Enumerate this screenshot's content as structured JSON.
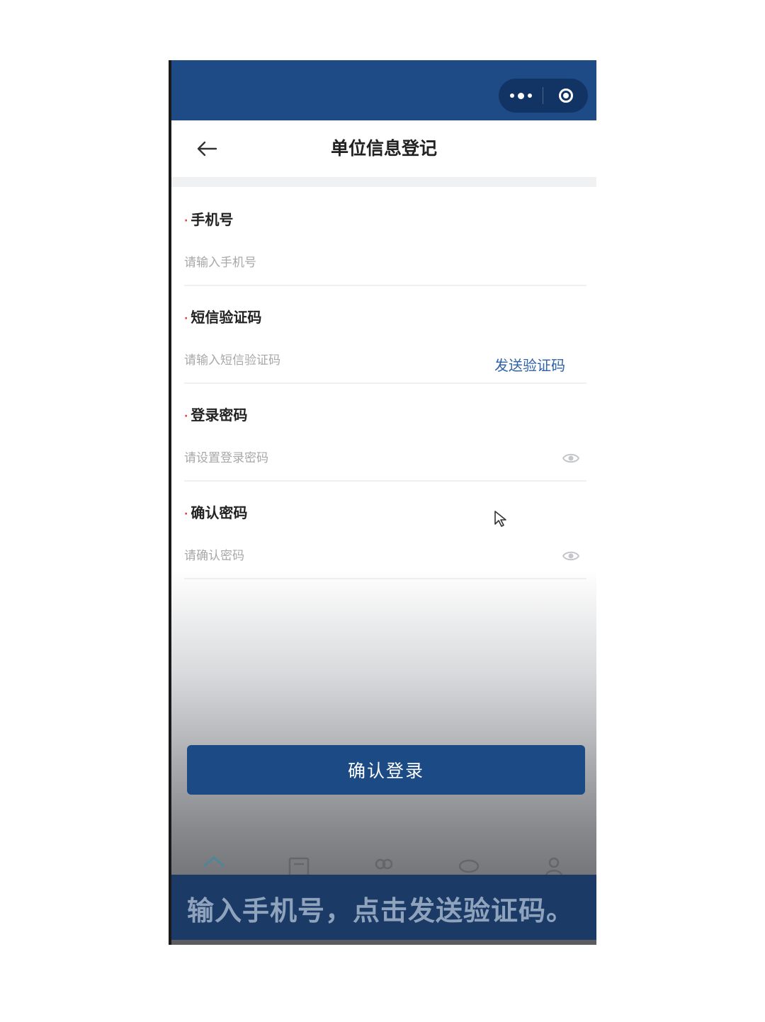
{
  "page": {
    "title": "单位信息登记"
  },
  "form": {
    "phone": {
      "label": "手机号",
      "placeholder": "请输入手机号",
      "value": ""
    },
    "sms_code": {
      "label": "短信验证码",
      "placeholder": "请输入短信验证码",
      "value": "",
      "send_label": "发送验证码"
    },
    "password": {
      "label": "登录密码",
      "placeholder": "请设置登录密码",
      "value": ""
    },
    "confirm_password": {
      "label": "确认密码",
      "placeholder": "请确认密码",
      "value": ""
    },
    "required_mark": "·"
  },
  "actions": {
    "confirm_label": "确认登录"
  },
  "caption": {
    "text": "输入手机号，点击发送验证码。"
  },
  "colors": {
    "header_blue": "#1e4b86",
    "button_blue": "#1c4a84",
    "link_blue": "#2e62a8",
    "required_red": "#e23c3c"
  },
  "icons": [
    "more-icon",
    "target-icon",
    "back-arrow-icon",
    "eye-icon",
    "home-icon",
    "document-icon",
    "group-icon",
    "chat-icon",
    "user-icon",
    "mouse-cursor-icon"
  ]
}
